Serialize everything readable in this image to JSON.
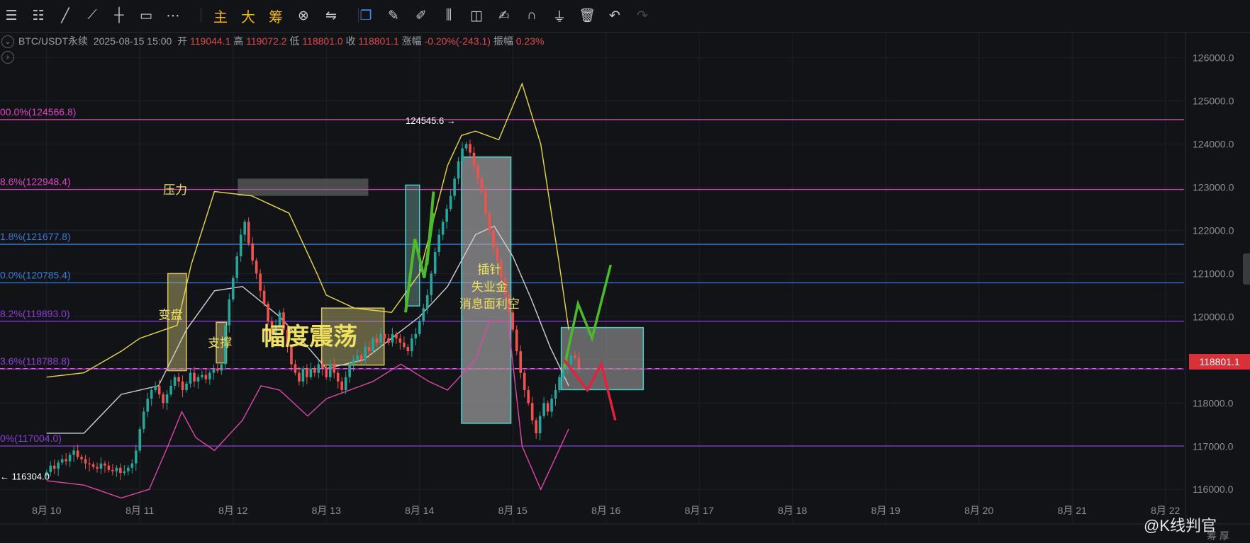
{
  "toolbar": {
    "tools": [
      {
        "name": "menu-icon",
        "glyph": "☰"
      },
      {
        "name": "horizontal-lines-icon",
        "glyph": "☷"
      },
      {
        "name": "trend-line-icon",
        "glyph": "╱"
      },
      {
        "name": "ray-line-icon",
        "glyph": "⟋"
      },
      {
        "name": "cross-line-icon",
        "glyph": "┼"
      },
      {
        "name": "rectangle-icon",
        "glyph": "▭"
      },
      {
        "name": "more-icon",
        "glyph": "⋯"
      }
    ],
    "main_label": "主",
    "big_label": "大",
    "chips_label": "筹",
    "right_tools": [
      {
        "name": "pin-icon",
        "glyph": "⊗"
      },
      {
        "name": "arrows-icon",
        "glyph": "⇋"
      },
      {
        "name": "copy-icon",
        "glyph": "❐"
      },
      {
        "name": "ruler-icon",
        "glyph": "✎"
      },
      {
        "name": "pen-icon",
        "glyph": "✐"
      },
      {
        "name": "candles-icon",
        "glyph": "⫼"
      },
      {
        "name": "bag-icon",
        "glyph": "◫"
      },
      {
        "name": "edit-icon",
        "glyph": "✍"
      },
      {
        "name": "magnet-icon",
        "glyph": "∩"
      },
      {
        "name": "filter-icon",
        "glyph": "⏚"
      },
      {
        "name": "trash-icon",
        "glyph": "🗑"
      },
      {
        "name": "undo-icon",
        "glyph": "↶"
      },
      {
        "name": "redo-icon",
        "glyph": "↷"
      }
    ]
  },
  "info": {
    "symbol": "BTC/USDT永续",
    "time": "2025-08-15 15:00",
    "open_label": "开",
    "open": "119044.1",
    "high_label": "高",
    "high": "119072.2",
    "low_label": "低",
    "low": "118801.0",
    "close_label": "收",
    "close": "118801.1",
    "change_label": "涨幅",
    "change": "-0.20%(-243.1)",
    "amp_label": "振幅",
    "amp": "0.23%"
  },
  "current_price": "118801.1",
  "colors": {
    "up": "#26a69a",
    "down": "#ef5350",
    "fib_magenta": "#e040c8",
    "fib_blue": "#3a7bd5",
    "fib_purple": "#8a3ed8",
    "boll_upper": "#e8d84a",
    "boll_mid": "#d0d0d0",
    "boll_lower": "#e046a8",
    "annotation_yellow": "#f0e060",
    "arrow_green": "#4cbb2a",
    "arrow_red": "#e5203a"
  },
  "chart_data": {
    "type": "candlestick",
    "ylim": [
      115200,
      126600
    ],
    "yticks": [
      "126000.0",
      "125000.0",
      "124000.0",
      "123000.0",
      "122000.0",
      "121000.0",
      "120000.0",
      "119000.0",
      "118000.0",
      "117000.0",
      "116000.0"
    ],
    "ytick_values": [
      126000,
      125000,
      124000,
      123000,
      122000,
      121000,
      120000,
      119000,
      118000,
      117000,
      116000
    ],
    "xlabels": [
      "8月 10",
      "8月 11",
      "8月 12",
      "8月 13",
      "8月 14",
      "8月 15",
      "8月 16",
      "8月 17",
      "8月 18",
      "8月 19",
      "8月 20",
      "8月 21",
      "8月 22"
    ],
    "xlabel_days": [
      10,
      11,
      12,
      13,
      14,
      15,
      16,
      17,
      18,
      19,
      20,
      21,
      22
    ],
    "fib_levels": [
      {
        "label": "00.0%(124566.8)",
        "price": 124566.8,
        "color": "#e040c8"
      },
      {
        "label": "8.6%(122948.4)",
        "price": 122948.4,
        "color": "#e040c8"
      },
      {
        "label": "1.8%(121677.8)",
        "price": 121677.8,
        "color": "#3a7bd5"
      },
      {
        "label": "0.0%(120785.4)",
        "price": 120785.4,
        "color": "#3a7bd5"
      },
      {
        "label": "8.2%(119893.0)",
        "price": 119893.0,
        "color": "#8a3ed8"
      },
      {
        "label": "3.6%(118788.8)",
        "price": 118788.8,
        "color": "#8a3ed8"
      },
      {
        "label": "0%(117004.0)",
        "price": 117004.0,
        "color": "#8a3ed8"
      }
    ],
    "high_marker": "124545.6",
    "low_marker": "116304.0",
    "ohlc_start_day": 10.0,
    "candle_step_day": 0.04167,
    "closes": [
      116400,
      116550,
      116480,
      116620,
      116700,
      116650,
      116800,
      116900,
      116750,
      116700,
      116600,
      116580,
      116520,
      116480,
      116600,
      116550,
      116450,
      116420,
      116500,
      116380,
      116420,
      116500,
      116600,
      116900,
      117400,
      117800,
      118100,
      118300,
      118400,
      118200,
      118000,
      118200,
      118400,
      118600,
      118500,
      118300,
      118450,
      118700,
      118500,
      118600,
      118650,
      118550,
      118700,
      118800,
      118750,
      118900,
      119800,
      120400,
      120900,
      121400,
      121900,
      122200,
      121700,
      121300,
      121000,
      120600,
      120300,
      119900,
      119600,
      119800,
      120100,
      119700,
      119300,
      118900,
      118700,
      118500,
      118800,
      118600,
      118800,
      118700,
      118900,
      118800,
      118600,
      118900,
      118700,
      118500,
      118300,
      118600,
      118900,
      119000,
      119100,
      119000,
      119300,
      119200,
      119500,
      119400,
      119600,
      119500,
      119400,
      119600,
      119500,
      119400,
      119300,
      119200,
      119500,
      119600,
      119900,
      120200,
      120500,
      121000,
      121500,
      121900,
      122200,
      122500,
      122800,
      123200,
      123600,
      123900,
      124000,
      123800,
      123500,
      123200,
      122900,
      122400,
      122000,
      121600,
      121300,
      120900,
      120500,
      120100,
      119700,
      119200,
      118700,
      118300,
      118000,
      117600,
      117300,
      117700,
      118000,
      117800,
      118100,
      118300,
      118600,
      118800,
      118900,
      119100,
      119044,
      118801
    ],
    "bollinger": {
      "upper": [
        [
          10.0,
          118600
        ],
        [
          10.4,
          118700
        ],
        [
          10.8,
          119200
        ],
        [
          11.0,
          119500
        ],
        [
          11.4,
          119800
        ],
        [
          11.55,
          121200
        ],
        [
          11.8,
          122900
        ],
        [
          12.2,
          122800
        ],
        [
          12.6,
          122400
        ],
        [
          12.9,
          121000
        ],
        [
          13.0,
          120500
        ],
        [
          13.3,
          120200
        ],
        [
          13.7,
          120100
        ],
        [
          14.0,
          121000
        ],
        [
          14.3,
          123500
        ],
        [
          14.45,
          124200
        ],
        [
          14.6,
          124300
        ],
        [
          14.85,
          124100
        ],
        [
          15.1,
          125400
        ],
        [
          15.3,
          124000
        ],
        [
          15.5,
          121200
        ],
        [
          15.6,
          119700
        ]
      ],
      "middle": [
        [
          10.0,
          117300
        ],
        [
          10.4,
          117300
        ],
        [
          10.8,
          118200
        ],
        [
          11.2,
          118400
        ],
        [
          11.5,
          119700
        ],
        [
          11.8,
          120600
        ],
        [
          12.1,
          120700
        ],
        [
          12.5,
          120000
        ],
        [
          12.8,
          119300
        ],
        [
          13.0,
          118800
        ],
        [
          13.4,
          119000
        ],
        [
          13.7,
          119500
        ],
        [
          14.0,
          120000
        ],
        [
          14.3,
          120700
        ],
        [
          14.6,
          121900
        ],
        [
          14.8,
          122100
        ],
        [
          15.0,
          121400
        ],
        [
          15.2,
          120400
        ],
        [
          15.4,
          119300
        ],
        [
          15.6,
          118400
        ]
      ],
      "lower": [
        [
          10.0,
          116200
        ],
        [
          10.4,
          116100
        ],
        [
          10.8,
          115800
        ],
        [
          11.1,
          116000
        ],
        [
          11.3,
          117000
        ],
        [
          11.45,
          117800
        ],
        [
          11.6,
          117200
        ],
        [
          11.8,
          116900
        ],
        [
          12.1,
          117600
        ],
        [
          12.3,
          118400
        ],
        [
          12.5,
          118300
        ],
        [
          12.8,
          117700
        ],
        [
          13.0,
          118100
        ],
        [
          13.5,
          118500
        ],
        [
          13.8,
          118900
        ],
        [
          14.1,
          118500
        ],
        [
          14.3,
          118300
        ],
        [
          14.6,
          119000
        ],
        [
          14.75,
          119900
        ],
        [
          14.95,
          119900
        ],
        [
          15.1,
          117000
        ],
        [
          15.3,
          116000
        ],
        [
          15.6,
          117400
        ]
      ]
    },
    "annotations": [
      {
        "text": "压力",
        "size": 17
      },
      {
        "text": "变盘",
        "size": 17
      },
      {
        "text": "支撑",
        "size": 17
      },
      {
        "text": "幅度震荡",
        "size": 34
      },
      {
        "text": "插针",
        "size": 17
      },
      {
        "text": "失业金",
        "size": 17
      },
      {
        "text": "消息面利空",
        "size": 17
      }
    ]
  },
  "watermark": "@K线判官",
  "bottom_right_text": "筹 厚"
}
